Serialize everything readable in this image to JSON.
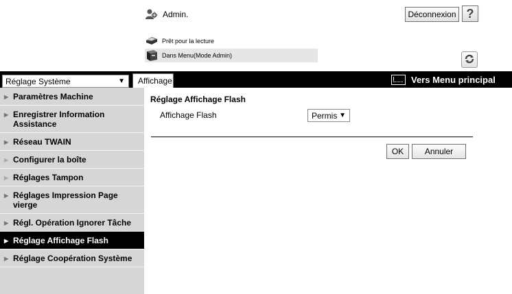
{
  "header": {
    "user_label": "Admin.",
    "logout_label": "Déconnexion",
    "help_label": "?",
    "status_ready": "Prêt pour la lecture",
    "status_mode": "Dans Menu(Mode Admin)"
  },
  "topbar": {
    "system_select_value": "Réglage Système",
    "tab_label": "Affichage",
    "menu_link_label": "Vers Menu principal"
  },
  "sidebar": {
    "items": [
      {
        "label": "Paramètres Machine",
        "active": false
      },
      {
        "label": "Enregistrer Information Assistance",
        "active": false
      },
      {
        "label": "Réseau TWAIN",
        "active": false
      },
      {
        "label": "Configurer la boîte",
        "active": false
      },
      {
        "label": "Réglages Tampon",
        "active": false
      },
      {
        "label": "Réglages Impression Page vierge",
        "active": false
      },
      {
        "label": "Régl. Opération Ignorer Tâche",
        "active": false
      },
      {
        "label": "Réglage Affichage Flash",
        "active": true
      },
      {
        "label": "Réglage Coopération Système",
        "active": false
      }
    ]
  },
  "main": {
    "section_title": "Réglage Affichage Flash",
    "field_label": "Affichage Flash",
    "flash_value": "Permis",
    "ok_label": "OK",
    "cancel_label": "Annuler"
  },
  "icons": {
    "admin": "admin-user-icon",
    "printer": "printer-icon",
    "refresh": "refresh-icon",
    "menu": "main-menu-icon"
  }
}
